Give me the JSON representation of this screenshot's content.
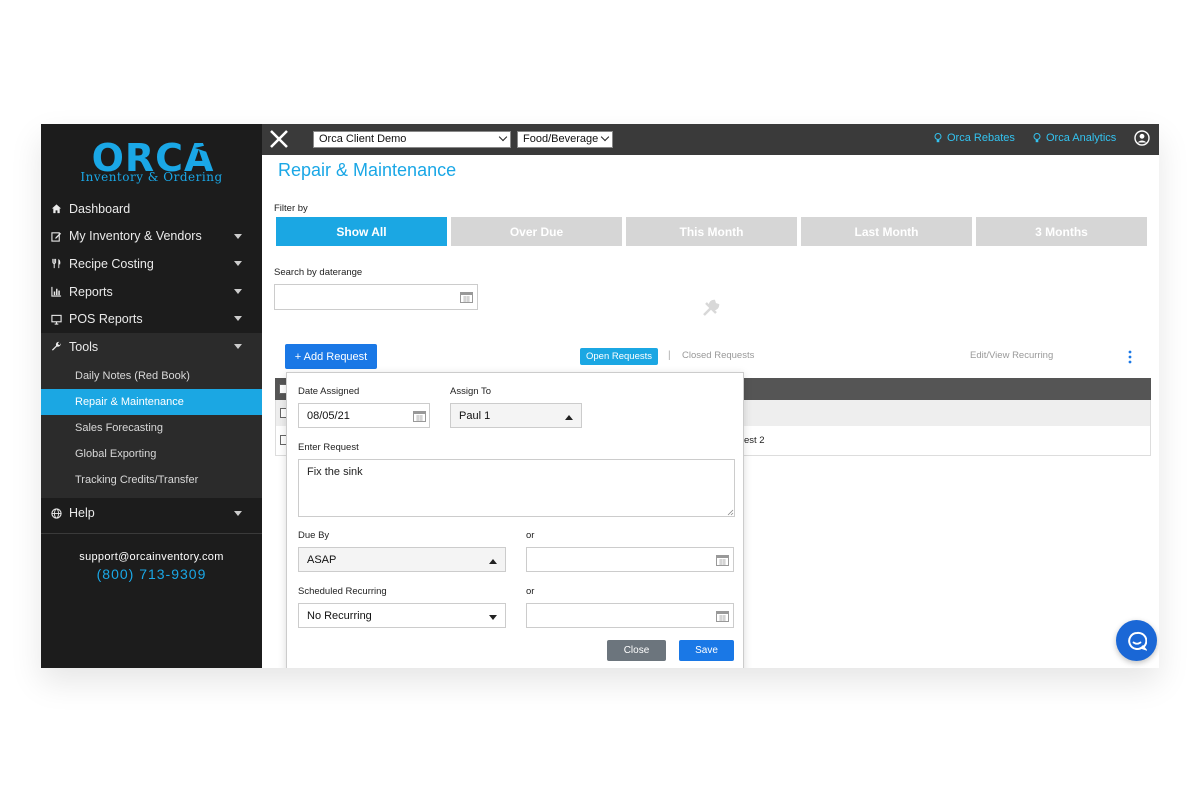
{
  "sidebar": {
    "logo_text": "ORCA",
    "logo_subtitle": "Inventory & Ordering",
    "items": [
      {
        "label": "Dashboard",
        "icon": "home-icon"
      },
      {
        "label": "My Inventory & Vendors",
        "icon": "edit-icon"
      },
      {
        "label": "Recipe Costing",
        "icon": "utensils-icon"
      },
      {
        "label": "Reports",
        "icon": "bar-chart-icon"
      },
      {
        "label": "POS Reports",
        "icon": "monitor-icon"
      },
      {
        "label": "Tools",
        "icon": "wrench-icon"
      }
    ],
    "tools_subitems": [
      "Daily Notes (Red Book)",
      "Repair & Maintenance",
      "Sales Forecasting",
      "Global Exporting",
      "Tracking Credits/Transfer"
    ],
    "help_label": "Help",
    "support_email": "support@orcainventory.com",
    "support_phone": "(800) 713-9309"
  },
  "topbar": {
    "client_select": "Orca Client Demo",
    "category_select": "Food/Beverage",
    "rebates_link": "Orca Rebates",
    "analytics_link": "Orca Analytics"
  },
  "main": {
    "title": "Repair & Maintenance",
    "filter_label": "Filter by",
    "filters": [
      "Show All",
      "Over Due",
      "This Month",
      "Last Month",
      "3 Months"
    ],
    "search_label": "Search by daterange",
    "add_request": "+ Add Request",
    "tabs": {
      "open": "Open Requests",
      "separator": "|",
      "closed": "Closed Requests",
      "recurring": "Edit/View Recurring"
    },
    "row2_text": "est 2"
  },
  "modal": {
    "date_assigned_label": "Date Assigned",
    "date_assigned_value": "08/05/21",
    "assign_to_label": "Assign To",
    "assign_to_value": "Paul 1",
    "enter_request_label": "Enter Request",
    "request_value": "Fix the sink",
    "due_by_label": "Due By",
    "due_by_value": "ASAP",
    "or_label": "or",
    "scheduled_label": "Scheduled Recurring",
    "scheduled_value": "No Recurring",
    "close_label": "Close",
    "save_label": "Save"
  },
  "colors": {
    "accent": "#1ba7e3",
    "primary_button": "#1a78e6",
    "sidebar_bg": "#1c1c1c",
    "topbar_bg": "#3a3a3a"
  }
}
